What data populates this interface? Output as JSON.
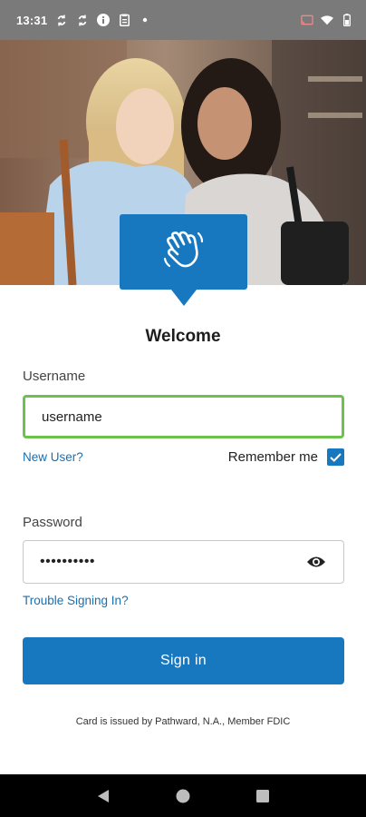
{
  "status_bar": {
    "time": "13:31",
    "left_icons": [
      "sync-icon",
      "sync-icon",
      "info-icon",
      "clipboard-icon",
      "dot-icon"
    ],
    "right_icons": [
      "cast-icon",
      "wifi-icon",
      "battery-icon"
    ]
  },
  "hero": {
    "badge_icon": "waving-hand-icon",
    "badge_color": "#1778c0"
  },
  "login": {
    "title": "Welcome",
    "username_label": "Username",
    "username_value": "username",
    "new_user_link": "New User?",
    "remember_me_label": "Remember me",
    "remember_me_checked": true,
    "password_label": "Password",
    "password_value": "••••••••••",
    "trouble_link": "Trouble Signing In?",
    "signin_button": "Sign in",
    "disclaimer": "Card is issued by Pathward, N.A., Member FDIC"
  },
  "colors": {
    "primary": "#1778c0",
    "focus_border": "#6cc24a",
    "link": "#1a6fb0"
  },
  "nav_bar": {
    "buttons": [
      "back-icon",
      "home-icon",
      "recents-icon"
    ]
  }
}
